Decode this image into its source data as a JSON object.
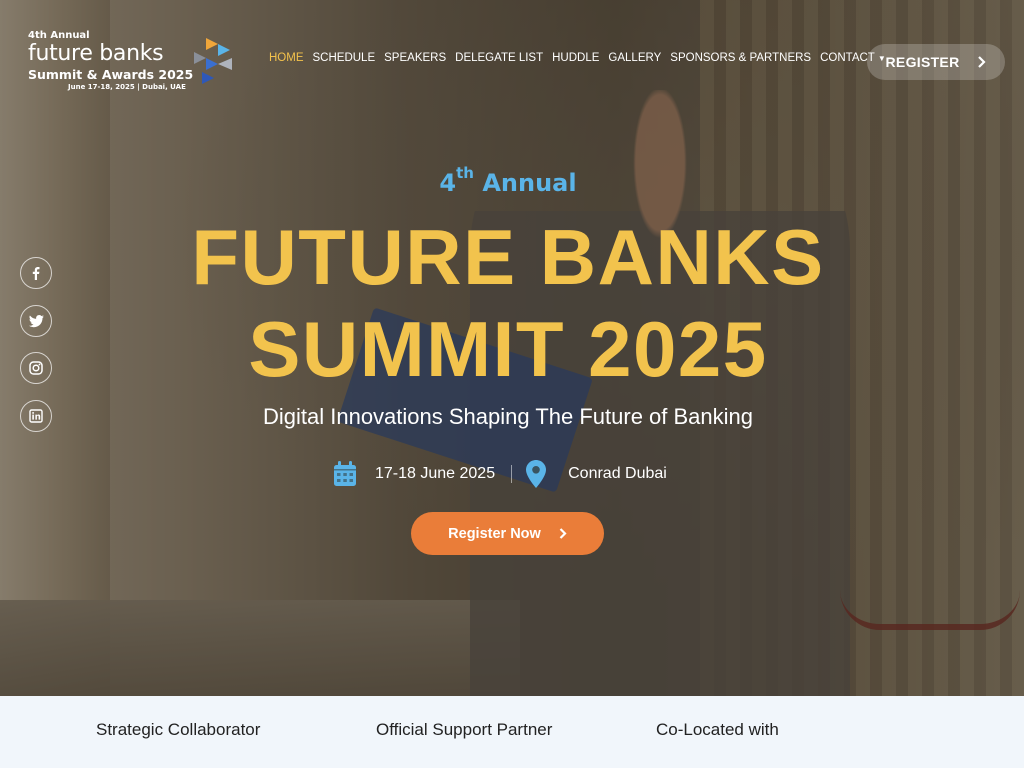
{
  "logo": {
    "line1": "4th Annual",
    "line2": "future banks",
    "line3": "Summit & Awards 2025",
    "line4": "June 17-18, 2025 | Dubai, UAE"
  },
  "nav": {
    "items": [
      "HOME",
      "SCHEDULE",
      "SPEAKERS",
      "DELEGATE LIST",
      "HUDDLE",
      "GALLERY",
      "SPONSORS & PARTNERS",
      "CONTACT"
    ],
    "active": "HOME"
  },
  "header": {
    "register_label": "REGISTER"
  },
  "social": [
    "facebook-icon",
    "twitter-icon",
    "instagram-icon",
    "linkedin-icon"
  ],
  "hero": {
    "annual_num": "4",
    "annual_sup": "th",
    "annual_word": "Annual",
    "title_line1": "FUTURE BANKS",
    "title_line2": "SUMMIT 2025",
    "subtitle": "Digital Innovations Shaping The Future of Banking",
    "date": "17-18 June 2025",
    "venue": "Conrad Dubai",
    "cta_label": "Register Now"
  },
  "partners": {
    "labels": [
      "Strategic Collaborator",
      "Official Support Partner",
      "Co-Located with"
    ]
  },
  "colors": {
    "accent_yellow": "#f2c34d",
    "accent_blue": "#5ab4e8",
    "cta_orange": "#ea7d39"
  }
}
